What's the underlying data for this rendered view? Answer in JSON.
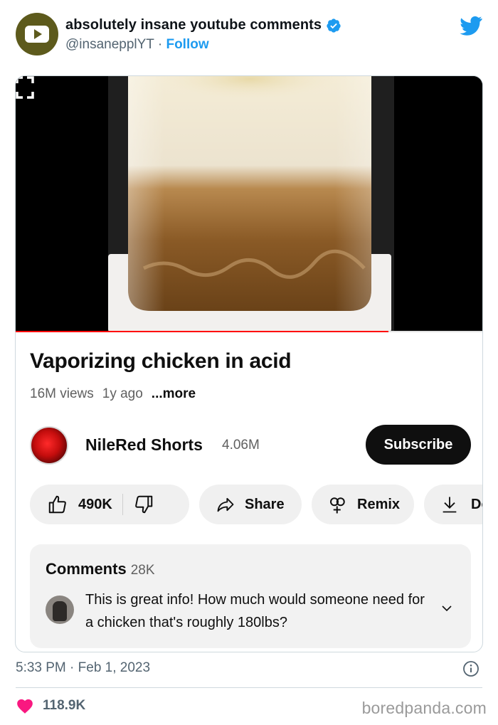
{
  "tweet": {
    "account_name": "absolutely insane youtube comments",
    "handle": "@insanepplYT",
    "separator": "·",
    "follow_label": "Follow",
    "timestamp": "5:33 PM · Feb 1, 2023",
    "likes_count": "118.9K"
  },
  "video": {
    "title": "Vaporizing chicken in acid",
    "views": "16M views",
    "age": "1y ago",
    "more_label": "...more",
    "progress": 0.797
  },
  "channel": {
    "name": "NileRed Shorts",
    "subscribers": "4.06M",
    "subscribe_label": "Subscribe"
  },
  "actions": {
    "likes": "490K",
    "share_label": "Share",
    "remix_label": "Remix",
    "download_label": "Do"
  },
  "comments": {
    "title": "Comments",
    "count": "28K",
    "top_comment": "This is great info! How much would someone need for a chicken that's roughly 180lbs?"
  },
  "watermark": "boredpanda.com",
  "colors": {
    "twitter_blue": "#1d9bf0",
    "youtube_red": "#ff0000",
    "heart": "#f91880",
    "avatar_olive": "#5d5a1c"
  },
  "icons": [
    "youtube-logo-icon",
    "verified-icon",
    "twitter-bird-icon",
    "fullscreen-icon",
    "thumbs-up-icon",
    "thumbs-down-icon",
    "share-icon",
    "remix-icon",
    "download-icon",
    "chevron-down-icon",
    "info-icon",
    "heart-icon"
  ]
}
